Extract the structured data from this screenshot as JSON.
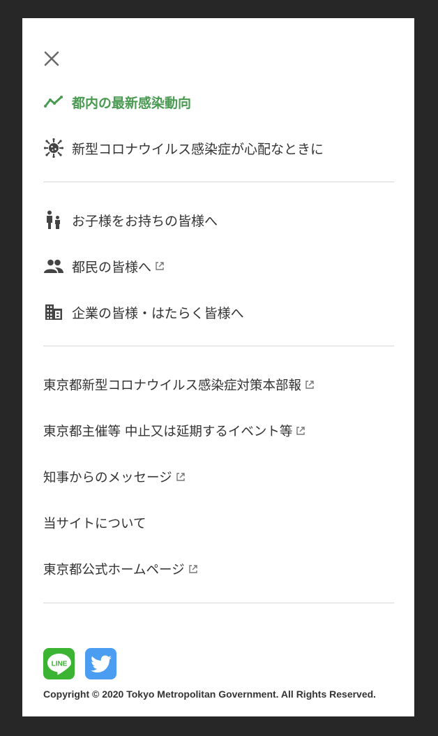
{
  "close_label": "close",
  "primary_nav": [
    {
      "label": "都内の最新感染動向",
      "icon": "trend-chart-icon"
    },
    {
      "label": "新型コロナウイルス感染症が心配なときに",
      "icon": "virus-icon"
    }
  ],
  "audience_nav": [
    {
      "label": "お子様をお持ちの皆様へ",
      "icon": "parent-child-icon"
    },
    {
      "label": "都民の皆様へ",
      "icon": "people-icon",
      "external": true
    },
    {
      "label": "企業の皆様・はたらく皆様へ",
      "icon": "building-icon"
    }
  ],
  "links": [
    {
      "label": "東京都新型コロナウイルス感染症対策本部報",
      "external": true
    },
    {
      "label": "東京都主催等 中止又は延期するイベント等",
      "external": true
    },
    {
      "label": "知事からのメッセージ",
      "external": true
    },
    {
      "label": "当サイトについて",
      "external": false
    },
    {
      "label": "東京都公式ホームページ",
      "external": true
    }
  ],
  "social": {
    "line_label": "LINE",
    "twitter_icon": "twitter-bird-icon"
  },
  "copyright": "Copyright © 2020 Tokyo Metropolitan Government. All Rights Reserved.",
  "colors": {
    "accent": "#4a9a52",
    "line": "#3bb433",
    "twitter": "#4a9df0",
    "text": "#333333",
    "backdrop": "#272727"
  }
}
